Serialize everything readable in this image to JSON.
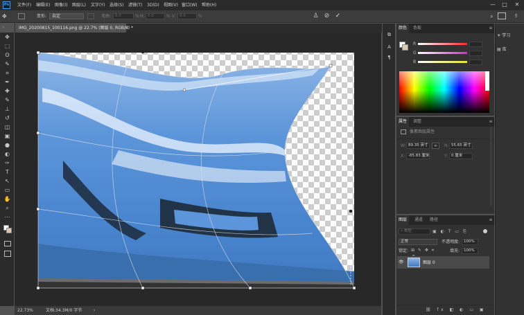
{
  "app": {
    "logo": "Ps"
  },
  "menubar": {
    "items": [
      "文件(F)",
      "编辑(E)",
      "图像(I)",
      "图层(L)",
      "文字(Y)",
      "选择(S)",
      "滤镜(T)",
      "3D(D)",
      "视图(V)",
      "窗口(W)",
      "帮助(H)"
    ],
    "window_controls": [
      "—",
      "□",
      "✕"
    ]
  },
  "options_bar": {
    "warp_label": "变形:",
    "warp_value": "自定",
    "bend_label": "弯曲:",
    "bend_value": "0.0",
    "bend_unit": "%",
    "h_label": "H:",
    "h_value": "0.0",
    "h_unit": "%",
    "v_label": "V:",
    "v_value": "0.0",
    "v_unit": "%"
  },
  "document": {
    "tab_title": "IMG_20200815_100116.png @ 22.7% (图层 0, RGB/8) *",
    "close": "×"
  },
  "toolbar": {
    "icons": [
      "move-icon",
      "marquee-icon",
      "lasso-icon",
      "quick-select-icon",
      "crop-icon",
      "eyedropper-icon",
      "healing-icon",
      "brush-icon",
      "stamp-icon",
      "history-brush-icon",
      "eraser-icon",
      "gradient-icon",
      "blur-icon",
      "dodge-icon",
      "pen-icon",
      "type-icon",
      "path-select-icon",
      "shape-icon",
      "hand-icon",
      "zoom-icon",
      "more-icon"
    ],
    "glyphs": [
      "✥",
      "⬚",
      "ʘ",
      "✎",
      "⌗",
      "✒",
      "✚",
      "✎",
      "⊥",
      "↺",
      "◫",
      "▣",
      "●",
      "◐",
      "✑",
      "T",
      "↖",
      "▭",
      "✋",
      "⌕",
      "⋯"
    ]
  },
  "status": {
    "zoom": "22.73%",
    "doc_info": "文档:34.3M/0 字节",
    "arrow": "›"
  },
  "color_panel": {
    "tabs": [
      "颜色",
      "色板"
    ],
    "channels": [
      {
        "label": "R",
        "color": "#ff2a2a"
      },
      {
        "label": "G",
        "color": "#d42ad4"
      },
      {
        "label": "B",
        "color": "#e4e42a"
      }
    ]
  },
  "properties_panel": {
    "tabs": [
      "属性",
      "调整"
    ],
    "layer_type": "像素图层属性",
    "w_label": "W:",
    "w_value": "89.35 英寸",
    "h_label": "H:",
    "h_value": "55.65 英寸",
    "x_label": "X:",
    "x_value": "-85.83 厘米",
    "y_label": "Y:",
    "y_value": "0 厘米"
  },
  "layers_panel": {
    "tabs": [
      "图层",
      "通道",
      "路径"
    ],
    "search_placeholder": "类型",
    "blend_mode": "正常",
    "opacity_label": "不透明度:",
    "opacity_value": "100%",
    "lock_label": "锁定:",
    "fill_label": "填充:",
    "fill_value": "100%",
    "layers": [
      {
        "name": "图层 0",
        "visible": "👁"
      }
    ]
  },
  "right_panel": {
    "buttons": [
      {
        "label": "学习",
        "icon": "lightbulb-icon"
      },
      {
        "label": "库",
        "icon": "library-icon"
      }
    ]
  },
  "colors": {
    "accent": "#31a8ff",
    "image_blue": "#4f8fd6"
  }
}
